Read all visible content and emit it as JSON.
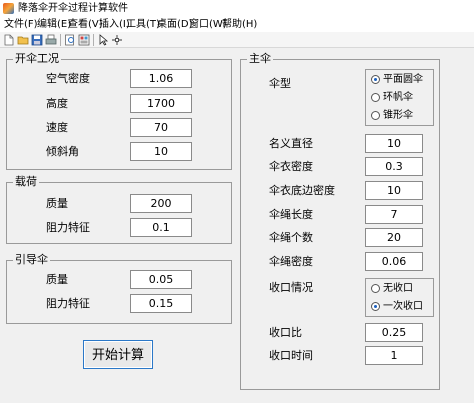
{
  "window": {
    "title": "降落伞开伞过程计算软件"
  },
  "menu": [
    "文件(F)",
    "编辑(E)",
    "查看(V)",
    "插入(I)",
    "工具(T)",
    "桌面(D)",
    "窗口(W)",
    "帮助(H)"
  ],
  "toolbar": {
    "icons": [
      "new-file-icon",
      "open-folder-icon",
      "save-icon",
      "print-icon",
      "print-preview-icon",
      "layout-icon",
      "pointer-icon",
      "data-cursor-icon"
    ]
  },
  "open_conditions": {
    "title": "开伞工况",
    "fields": [
      {
        "label": "空气密度",
        "value": "1.06"
      },
      {
        "label": "高度",
        "value": "1700"
      },
      {
        "label": "速度",
        "value": "70"
      },
      {
        "label": "倾斜角",
        "value": "10"
      }
    ]
  },
  "load": {
    "title": "载荷",
    "fields": [
      {
        "label": "质量",
        "value": "200"
      },
      {
        "label": "阻力特征",
        "value": "0.1"
      }
    ]
  },
  "pilot_chute": {
    "title": "引导伞",
    "fields": [
      {
        "label": "质量",
        "value": "0.05"
      },
      {
        "label": "阻力特征",
        "value": "0.15"
      }
    ]
  },
  "main_chute": {
    "title": "主伞",
    "type_label": "伞型",
    "type_options": [
      {
        "label": "平面圆伞",
        "selected": true
      },
      {
        "label": "环帆伞",
        "selected": false
      },
      {
        "label": "锥形伞",
        "selected": false
      }
    ],
    "fields": [
      {
        "label": "名义直径",
        "value": "10"
      },
      {
        "label": "伞衣密度",
        "value": "0.3"
      },
      {
        "label": "伞衣底边密度",
        "value": "10"
      },
      {
        "label": "伞绳长度",
        "value": "7"
      },
      {
        "label": "伞绳个数",
        "value": "20"
      },
      {
        "label": "伞绳密度",
        "value": "0.06"
      }
    ],
    "reefing_label": "收口情况",
    "reefing_options": [
      {
        "label": "无收口",
        "selected": false
      },
      {
        "label": "一次收口",
        "selected": true
      }
    ],
    "reefing_fields": [
      {
        "label": "收口比",
        "value": "0.25"
      },
      {
        "label": "收口时间",
        "value": "1"
      }
    ]
  },
  "actions": {
    "start_label": "开始计算"
  },
  "colors": {
    "accent": "#2b78c8",
    "radio_dot": "#1a5fbf",
    "panel": "#f0f0f0",
    "border": "#9a9a9a"
  }
}
